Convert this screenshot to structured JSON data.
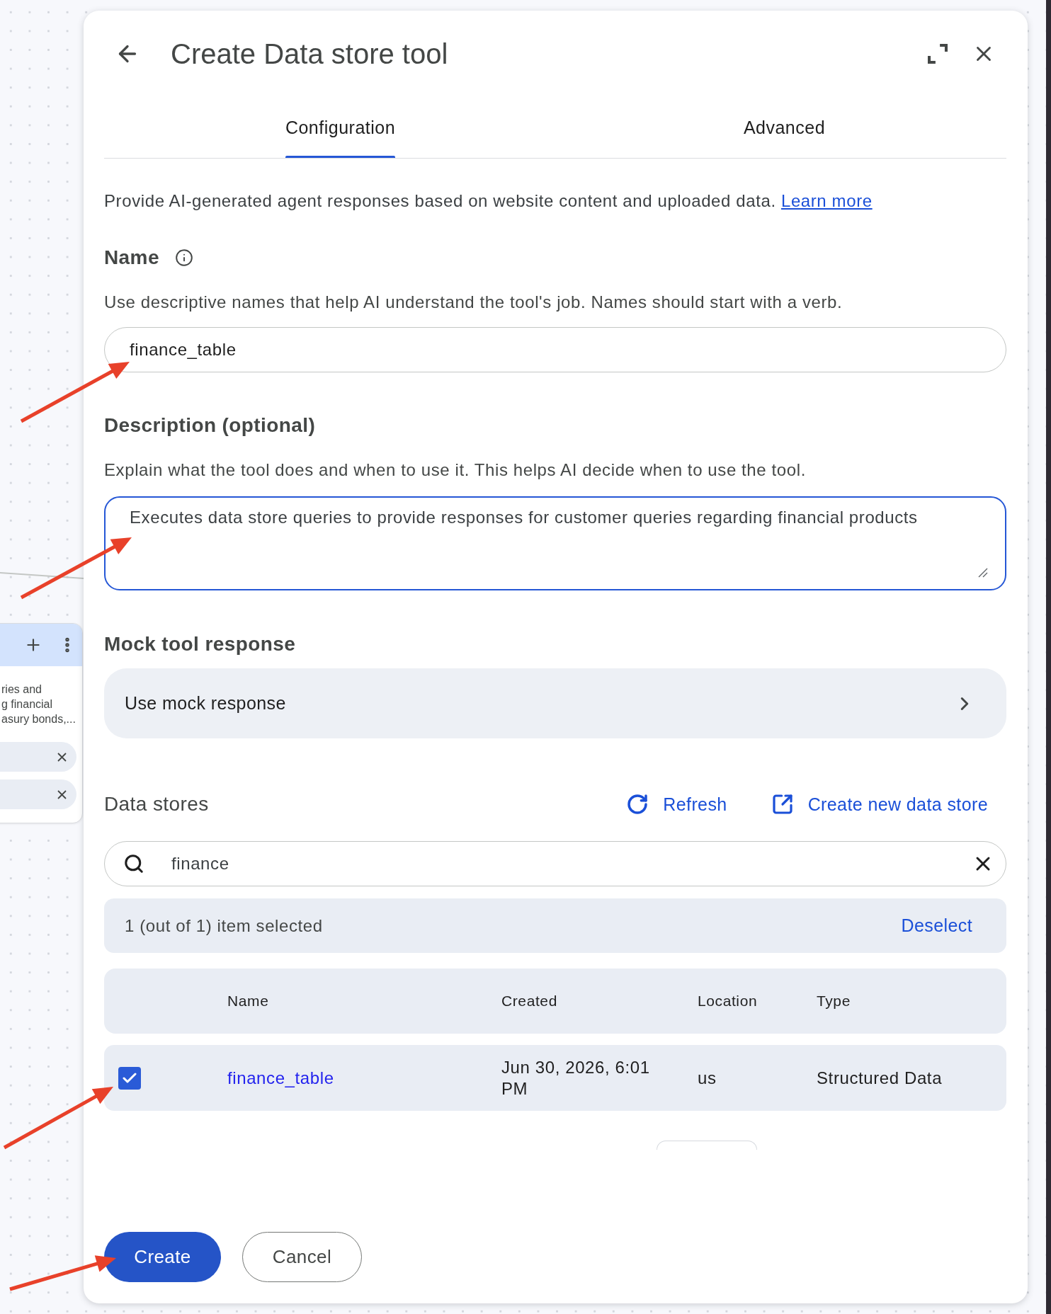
{
  "canvas_node": {
    "description_lines": [
      "ries and",
      "g financial",
      "asury bonds,..."
    ],
    "chips": [
      {
        "removable": true
      },
      {
        "removable": true
      }
    ]
  },
  "dialog": {
    "title": "Create Data store tool",
    "tabs": [
      {
        "label": "Configuration",
        "selected": true
      },
      {
        "label": "Advanced",
        "selected": false
      }
    ],
    "intro": {
      "text": "Provide AI-generated agent responses based on website content and uploaded data.",
      "link": "Learn more"
    },
    "name_field": {
      "label": "Name",
      "hint": "Use descriptive names that help AI understand the tool's job. Names should start with a verb.",
      "value": "finance_table",
      "focused": false
    },
    "description_field": {
      "label": "Description (optional)",
      "hint": "Explain what the tool does and when to use it. This helps AI decide when to use the tool.",
      "value": "Executes data store queries to provide responses for customer queries regarding financial products",
      "focused": true
    },
    "mock_tool_response": {
      "label": "Mock tool response",
      "option": "Use mock response"
    },
    "data_stores": {
      "label": "Data stores",
      "actions": [
        {
          "kind": "refresh",
          "label": "Refresh"
        },
        {
          "kind": "create",
          "label": "Create new data store"
        }
      ],
      "search": {
        "value": "finance"
      },
      "selection": {
        "summary": "1 (out of 1) item selected",
        "action": "Deselect"
      },
      "table": {
        "columns": [
          "Name",
          "Created",
          "Location",
          "Type"
        ],
        "rows": [
          {
            "checked": true,
            "name": "finance_table",
            "created": "Jun 30, 2026, 6:01 PM",
            "location": "us",
            "type": "Structured Data"
          }
        ]
      }
    },
    "buttons": [
      {
        "kind": "primary",
        "label": "Create"
      },
      {
        "kind": "secondary",
        "label": "Cancel"
      }
    ]
  }
}
